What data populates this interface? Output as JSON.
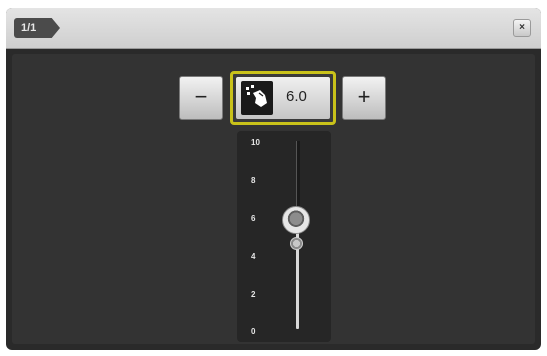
{
  "window": {
    "page_indicator": "1/1",
    "close_label": "×"
  },
  "controls": {
    "minus_label": "−",
    "plus_label": "+",
    "value": "6.0",
    "value_icon": "presser-foot-pressure-icon"
  },
  "scale": {
    "ticks": [
      "10",
      "8",
      "6",
      "4",
      "2",
      "0"
    ],
    "min": 0,
    "max": 10,
    "current": 6.0,
    "default_marker": 4.5
  }
}
